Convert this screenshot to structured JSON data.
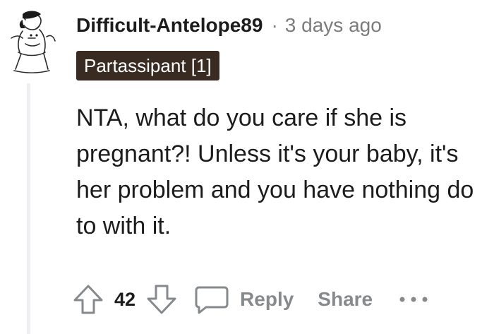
{
  "comment": {
    "username": "Difficult-Antelope89",
    "separator": "·",
    "timestamp": "3 days ago",
    "flair": "Partassipant [1]",
    "body": "NTA, what do you care if she is pregnant?! Unless it's your baby, it's her problem and you have nothing do to with it.",
    "avatar_icon": "user-avatar-illustration",
    "actions": {
      "upvote_icon": "upvote-arrow-icon",
      "score": "42",
      "downvote_icon": "downvote-arrow-icon",
      "reply_icon": "comment-bubble-icon",
      "reply_label": "Reply",
      "share_label": "Share",
      "more_icon": "ellipsis-icon"
    }
  },
  "colors": {
    "text": "#1c1c1c",
    "meta": "#7c7c7c",
    "action_gray": "#878a8c",
    "flair_bg": "#3a2b22",
    "flair_text": "#ffffff",
    "thread_line": "#edeff1"
  }
}
